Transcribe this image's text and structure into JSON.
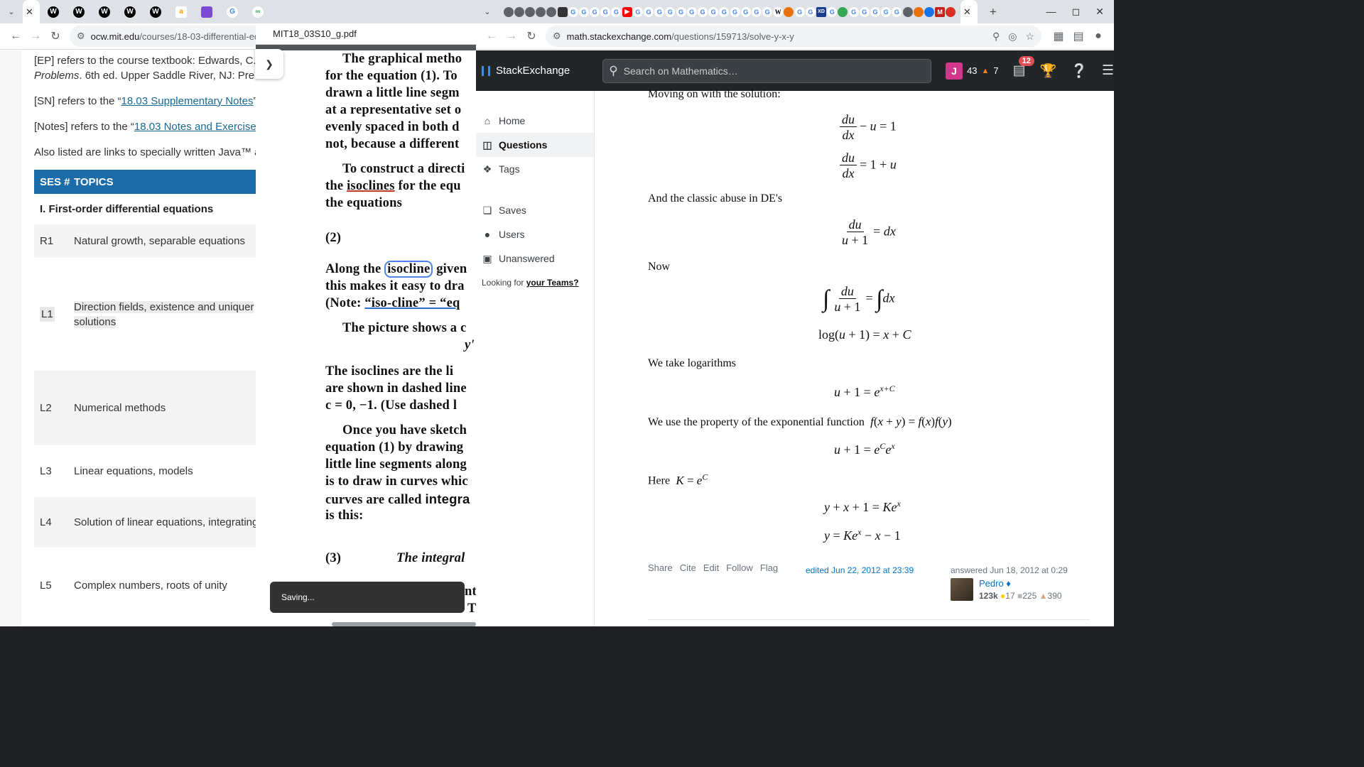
{
  "left_window": {
    "tabstrip": {
      "favicons": [
        "wiki-icon",
        "wiki-icon",
        "wiki-icon",
        "wiki-icon",
        "wiki-icon",
        "amazon-icon",
        "cube-icon",
        "google-icon",
        "link-icon"
      ]
    },
    "address": {
      "host": "ocw.mit.edu",
      "path": "/courses/18-03-differential-equat"
    },
    "mit": {
      "p1_a": "[EP] refers to the course textbook: Edwards, C.,",
      "p1_b_italic": "Problems",
      "p1_b_rest": ". 6th ed. Upper Saddle River, NJ: Pren",
      "p2_pre": "[SN] refers to the “",
      "p2_link": "18.03 Supplementary Notes",
      "p2_post": "”",
      "p3_pre": "[Notes] refers to the “",
      "p3_link": "18.03 Notes and Exercises",
      "p4": "Also listed are links to specially written Java™ a",
      "table_header": {
        "ses": "SES #",
        "topics": "TOPICS"
      },
      "section": "I. First-order differential equations",
      "rows": [
        {
          "ses": "R1",
          "topic": "Natural growth, separable equations",
          "topic2": ""
        },
        {
          "ses": "L1",
          "topic": "Direction fields, existence and uniquer",
          "topic2": "solutions"
        },
        {
          "ses": "L2",
          "topic": "Numerical methods",
          "topic2": ""
        },
        {
          "ses": "L3",
          "topic": "Linear equations, models",
          "topic2": ""
        },
        {
          "ses": "L4",
          "topic": "Solution of linear equations, integrating",
          "topic2": ""
        },
        {
          "ses": "L5",
          "topic": "Complex numbers, roots of unity",
          "topic2": ""
        }
      ]
    },
    "pdf": {
      "filename": "MIT18_03S10_g.pdf",
      "lines": [
        "The graphical metho",
        "for the equation (1). To",
        "drawn a little line segm",
        "at a representative set o",
        "evenly spaced in both d",
        "not, because a different"
      ],
      "l7": "To construct a directi",
      "l8_pre": "the ",
      "l8_ul": "isoclines",
      "l8_post": " for the equ",
      "l9": "the equations",
      "eq2": "(2)",
      "l10_pre": "Along the ",
      "l10_circ": "isocline",
      "l10_post": " given",
      "l11": "this makes it easy to dra",
      "l12_pre": "(Note: ",
      "l12_ul": "“iso-cline” = “eq",
      "l13": "The picture shows a c",
      "l14": "y'",
      "l15": "The isoclines are the li",
      "l16": "are shown in dashed line",
      "l17": "c = 0, −1.  (Use dashed l",
      "l18": "Once you have sketch",
      "l19": "equation (1) by drawing",
      "l20": "little line segments along",
      "l21": "is to draw in curves whic",
      "l22_pre": "curves are called ",
      "l22_bold": "integra",
      "l23": "is this:",
      "eq3": "(3)",
      "eq3_text": "The integral",
      "l24": "nt",
      "l25": "T"
    },
    "toast": "Saving..."
  },
  "right_window": {
    "address": {
      "host": "math.stackexchange.com",
      "path": "/questions/159713/solve-y-x-y"
    },
    "topbar": {
      "logo_a": "Stack",
      "logo_b": "Exchange",
      "search_placeholder": "Search on Mathematics…",
      "avatar_letter": "J",
      "reputation": "43",
      "bronze_count": "7",
      "inbox_count": "12"
    },
    "nav": {
      "home": "Home",
      "questions": "Questions",
      "tags": "Tags",
      "saves": "Saves",
      "users": "Users",
      "unanswered": "Unanswered",
      "teams_pre": "Looking for ",
      "teams_link": "your Teams?"
    },
    "answer": {
      "t1": "Moving on with the solution:",
      "t2": "And the classic abuse in DE's",
      "t3": "Now",
      "t4": "We take logarithms",
      "t5": "We use the property of the exponential function",
      "t6": "Here",
      "menu": [
        "Share",
        "Cite",
        "Edit",
        "Follow",
        "Flag"
      ],
      "edited": "edited Jun 22, 2012 at 23:39",
      "answered": "answered Jun 18, 2012 at 0:29",
      "user": {
        "name": "Pedro ♦",
        "rep": "123k",
        "gold": "17",
        "silver": "225",
        "bronze": "390"
      }
    }
  }
}
